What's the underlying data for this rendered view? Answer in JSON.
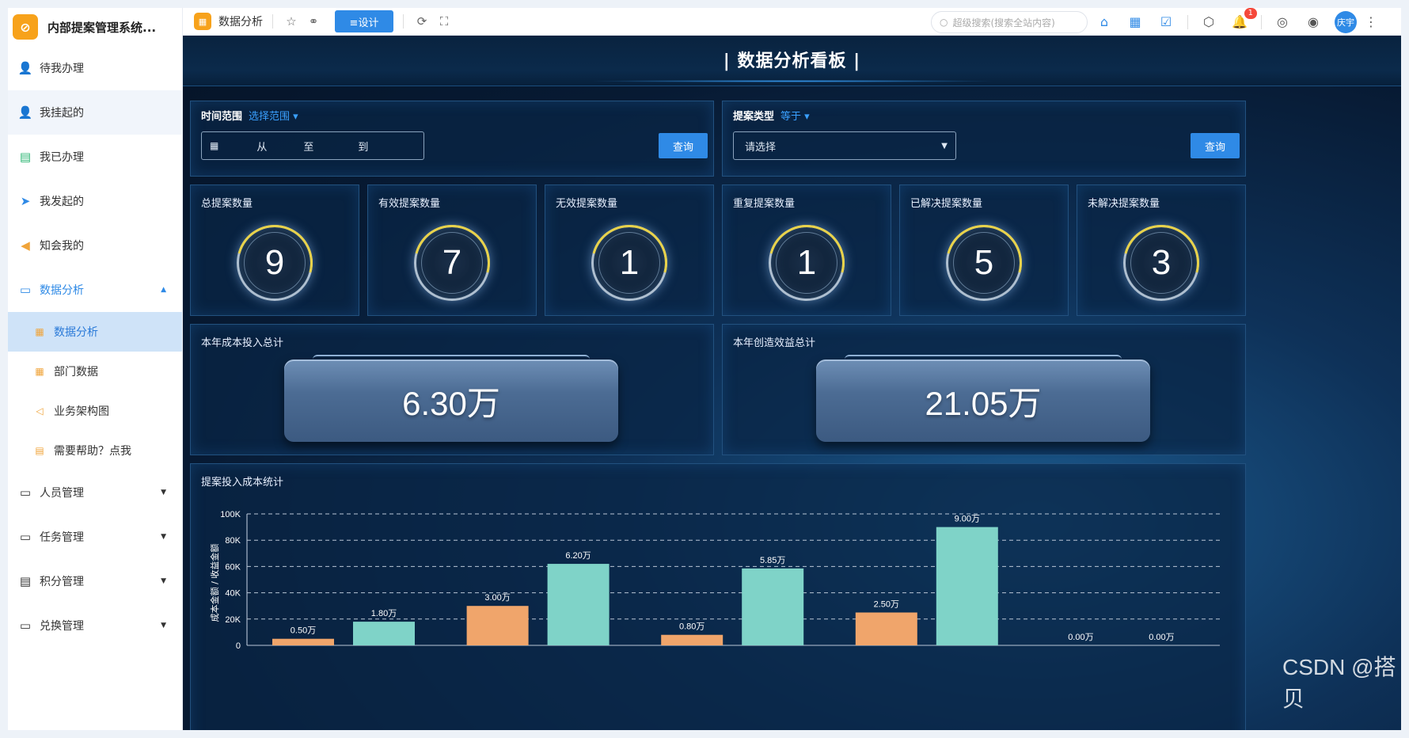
{
  "app": {
    "title": "内部提案管理系统..."
  },
  "sidebar": {
    "items": [
      {
        "label": "待我办理",
        "icon": "user-icon"
      },
      {
        "label": "我挂起的",
        "icon": "user-pause-icon"
      },
      {
        "label": "我已办理",
        "icon": "done-icon"
      },
      {
        "label": "我发起的",
        "icon": "send-icon"
      },
      {
        "label": "知会我的",
        "icon": "speaker-icon"
      }
    ],
    "group_analysis": {
      "label": "数据分析",
      "icon": "folder-icon"
    },
    "sub_items": [
      {
        "label": "数据分析",
        "icon": "chart-icon"
      },
      {
        "label": "部门数据",
        "icon": "chart-icon"
      },
      {
        "label": "业务架构图",
        "icon": "speaker-icon"
      },
      {
        "label": "需要帮助？点我",
        "icon": "message-icon"
      }
    ],
    "groups": [
      {
        "label": "人员管理",
        "icon": "folder-icon"
      },
      {
        "label": "任务管理",
        "icon": "folder-icon"
      },
      {
        "label": "积分管理",
        "icon": "list-icon"
      },
      {
        "label": "兑换管理",
        "icon": "folder-icon"
      }
    ]
  },
  "topbar": {
    "page_title": "数据分析",
    "design_label": "≡设计",
    "search_placeholder": "超级搜索(搜索全站内容)",
    "notification_count": "1",
    "user_name": "庆宇"
  },
  "dashboard": {
    "title": "| 数据分析看板 |",
    "filter_time": {
      "label": "时间范围",
      "operator": "选择范围 ▾",
      "from": "从",
      "to1": "至",
      "to2": "到",
      "button": "查询"
    },
    "filter_type": {
      "label": "提案类型",
      "operator": "等于 ▾",
      "placeholder": "请选择",
      "button": "查询"
    },
    "stats": [
      {
        "label": "总提案数量",
        "value": "9"
      },
      {
        "label": "有效提案数量",
        "value": "7"
      },
      {
        "label": "无效提案数量",
        "value": "1"
      },
      {
        "label": "重复提案数量",
        "value": "1"
      },
      {
        "label": "已解决提案数量",
        "value": "5"
      },
      {
        "label": "未解决提案数量",
        "value": "3"
      }
    ],
    "cost_total": {
      "label": "本年成本投入总计",
      "value": "6.30万"
    },
    "benefit_total": {
      "label": "本年创造效益总计",
      "value": "21.05万"
    },
    "chart_title": "提案投入成本统计"
  },
  "chart_data": {
    "type": "bar",
    "title": "提案投入成本统计",
    "ylabel": "成本金额 / 收益金额",
    "ylim": [
      0,
      100000
    ],
    "yticks": [
      "0",
      "20K",
      "40K",
      "60K",
      "80K",
      "100K"
    ],
    "grid": true,
    "colors": {
      "cost": "#f0a56b",
      "benefit": "#7fd3c8"
    },
    "groups": [
      {
        "cost": 5000,
        "cost_label": "0.50万",
        "benefit": 18000,
        "benefit_label": "1.80万"
      },
      {
        "cost": 30000,
        "cost_label": "3.00万",
        "benefit": 62000,
        "benefit_label": "6.20万"
      },
      {
        "cost": 8000,
        "cost_label": "0.80万",
        "benefit": 58500,
        "benefit_label": "5.85万"
      },
      {
        "cost": 25000,
        "cost_label": "2.50万",
        "benefit": 90000,
        "benefit_label": "9.00万"
      },
      {
        "cost": 0,
        "cost_label": "0.00万",
        "benefit": 0,
        "benefit_label": "0.00万"
      }
    ]
  },
  "watermark": "CSDN @搭贝"
}
